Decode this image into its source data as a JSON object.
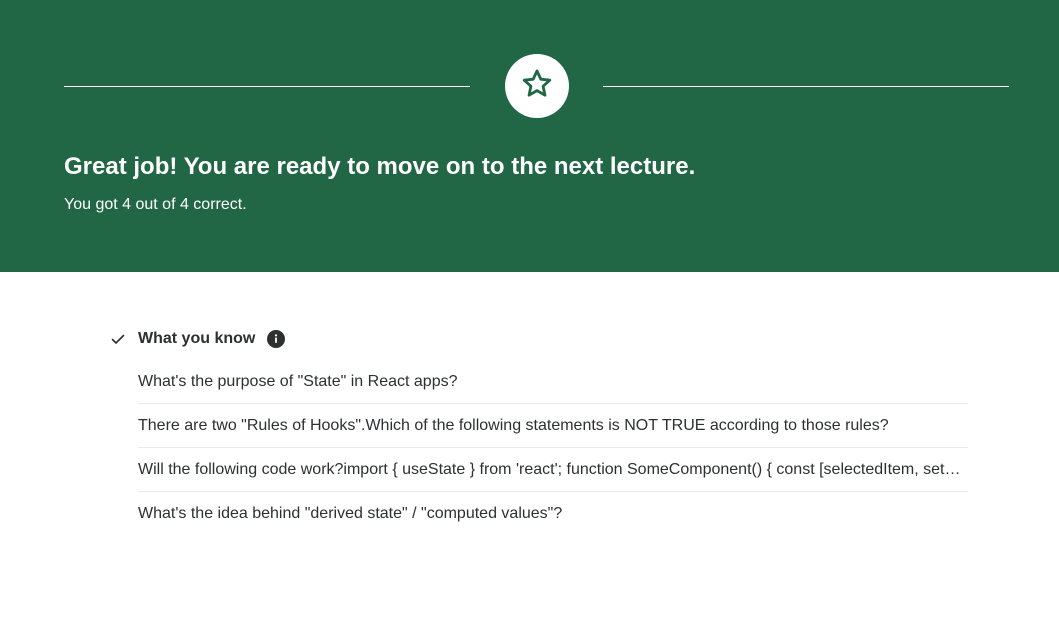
{
  "banner": {
    "icon": "star-icon",
    "headline": "Great job! You are ready to move on to the next lecture.",
    "score_text": "You got 4 out of 4 correct.",
    "background_color": "#216645"
  },
  "section": {
    "check_icon": "check-icon",
    "title": "What you know",
    "info_icon": "info-icon",
    "questions": [
      "What's the purpose of \"State\" in React apps?",
      "There are two \"Rules of Hooks\".Which of the following statements is NOT TRUE according to those rules?",
      "Will the following code work?import { useState } from 'react'; function SomeComponent() { const [selectedItem, setSelectedItem] = useState();",
      "What's the idea behind \"derived state\" / \"computed values\"?"
    ]
  }
}
